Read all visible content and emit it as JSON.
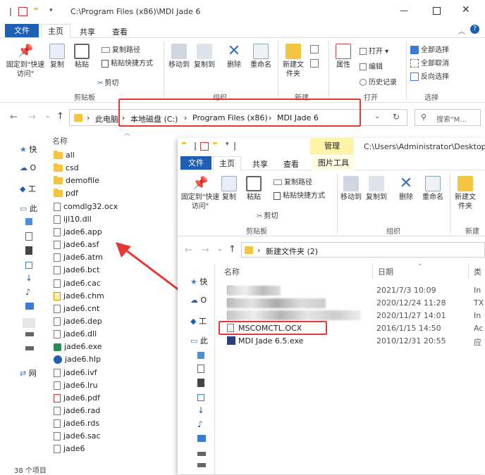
{
  "back": {
    "title_path": "C:\\Program Files (x86)\\MDI Jade 6",
    "tabs": [
      "文件",
      "主页",
      "共享",
      "查看"
    ],
    "ribbon": {
      "pin": "固定到\"快速访问\"",
      "copy": "复制",
      "paste": "粘贴",
      "copy_path": "复制路径",
      "paste_shortcut": "粘贴快捷方式",
      "cut": "剪切",
      "clipboard": "剪贴板",
      "move_to": "移动到",
      "copy_to": "复制到",
      "delete": "删除",
      "rename": "重命名",
      "organize": "组织",
      "new_folder": "新建文件夹",
      "new": "新建",
      "properties": "属性",
      "open": "打开",
      "edit": "编辑",
      "history": "历史记录",
      "open_group": "打开",
      "select_all": "全部选择",
      "select_none": "全部取消",
      "invert": "反向选择",
      "select": "选择"
    },
    "breadcrumb": [
      "此电脑",
      "本地磁盘 (C:)",
      "Program Files (x86)",
      "MDI Jade 6"
    ],
    "search_placeholder": "搜索\"M...",
    "col_name": "名称",
    "nav": [
      "快",
      "O",
      "工",
      "此",
      "网"
    ],
    "files": [
      {
        "name": "all",
        "type": "folder"
      },
      {
        "name": "csd",
        "type": "folder"
      },
      {
        "name": "demofile",
        "type": "folder"
      },
      {
        "name": "pdf",
        "type": "folder"
      },
      {
        "name": "comdlg32.ocx",
        "type": "file"
      },
      {
        "name": "ijl10.dll",
        "type": "file"
      },
      {
        "name": "jade6.app",
        "type": "file"
      },
      {
        "name": "jade6.asf",
        "type": "file"
      },
      {
        "name": "jade6.atm",
        "type": "file"
      },
      {
        "name": "jade6.bct",
        "type": "file"
      },
      {
        "name": "jade6.cac",
        "type": "file"
      },
      {
        "name": "jade6.chm",
        "type": "chm"
      },
      {
        "name": "jade6.cnt",
        "type": "file"
      },
      {
        "name": "jade6.dep",
        "type": "file"
      },
      {
        "name": "jade6.dll",
        "type": "file"
      },
      {
        "name": "jade6.exe",
        "type": "exe"
      },
      {
        "name": "jade6.hlp",
        "type": "hlp"
      },
      {
        "name": "jade6.ivf",
        "type": "file"
      },
      {
        "name": "jade6.lru",
        "type": "file"
      },
      {
        "name": "jade6.pdf",
        "type": "pdf"
      },
      {
        "name": "jade6.rad",
        "type": "file"
      },
      {
        "name": "jade6.rds",
        "type": "file"
      },
      {
        "name": "jade6.sac",
        "type": "file"
      },
      {
        "name": "jade6",
        "type": "file"
      }
    ],
    "status": "38 个项目"
  },
  "front": {
    "context_tab": "管理",
    "title_path": "C:\\Users\\Administrator\\Desktop\\",
    "tabs": [
      "文件",
      "主页",
      "共享",
      "查看",
      "图片工具"
    ],
    "breadcrumb": [
      "新建文件夹 (2)"
    ],
    "col_name": "名称",
    "col_date": "日期",
    "col_type": "类",
    "rows": [
      {
        "name": "",
        "date": "2021/7/3 10:09",
        "type": "In"
      },
      {
        "name": "",
        "date": "2020/12/24 11:28",
        "type": "TX"
      },
      {
        "name": "",
        "date": "2020/11/27 14:01",
        "type": "In"
      },
      {
        "name": "MSCOMCTL.OCX",
        "date": "2016/1/15 14:50",
        "type": "Ac"
      },
      {
        "name": "MDI Jade 6.5.exe",
        "date": "2010/12/31 20:55",
        "type": "应"
      }
    ],
    "nav": [
      "快",
      "O",
      "工",
      "此"
    ]
  },
  "colors": {
    "accent": "#1e5fb4",
    "highlight": "#e53935",
    "folder": "#f5c542",
    "context_tab": "#fff3a8"
  }
}
